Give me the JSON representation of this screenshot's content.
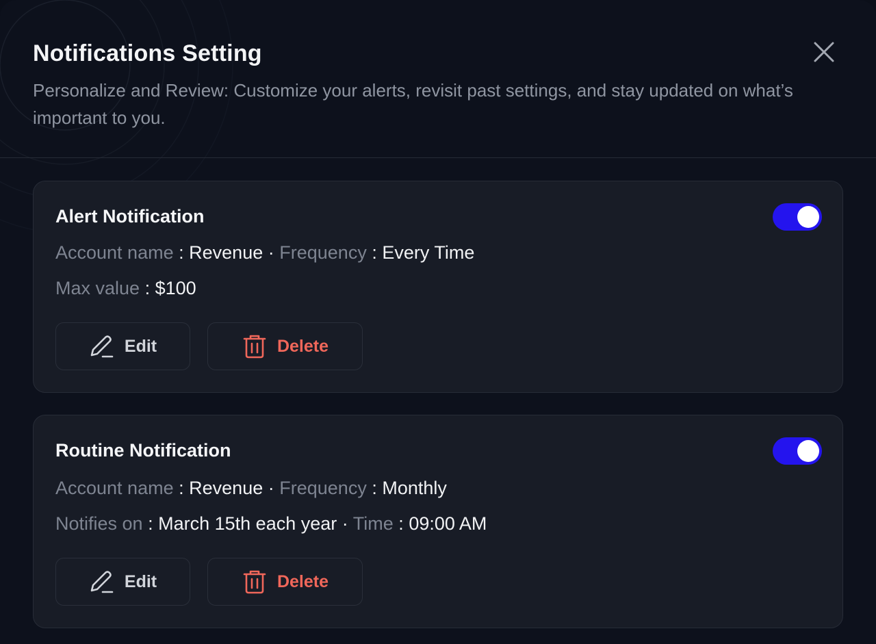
{
  "header": {
    "title": "Notifications Setting",
    "subtitle": "Personalize and Review: Customize your alerts, revisit past settings, and stay updated on what’s important to you.",
    "close_icon": "close-icon"
  },
  "colors": {
    "toggle_on": "#2414ee",
    "delete": "#f0675a",
    "background": "#0d111c",
    "card": "#181c26"
  },
  "cards": [
    {
      "title": "Alert Notification",
      "enabled": true,
      "line1": {
        "label1": "Account name",
        "value1": "Revenue",
        "label2": "Frequency",
        "value2": "Every Time"
      },
      "line2": {
        "label1": "Max value",
        "value1": "$100"
      },
      "edit_label": "Edit",
      "delete_label": "Delete"
    },
    {
      "title": "Routine Notification",
      "enabled": true,
      "line1": {
        "label1": "Account name",
        "value1": "Revenue",
        "label2": "Frequency",
        "value2": "Monthly"
      },
      "line2": {
        "label1": "Notifies on",
        "value1": "March 15th each year",
        "label2": "Time",
        "value2": "09:00 AM"
      },
      "edit_label": "Edit",
      "delete_label": "Delete"
    }
  ]
}
